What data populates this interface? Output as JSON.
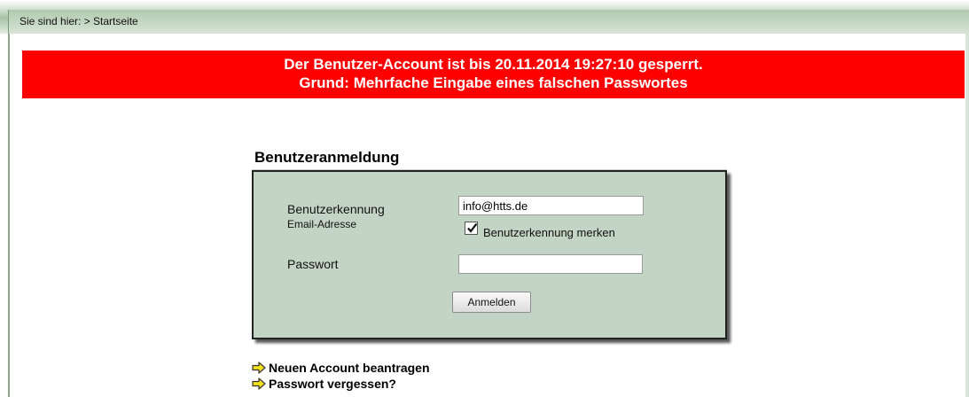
{
  "breadcrumb": {
    "text": "Sie sind hier: > Startseite"
  },
  "alert": {
    "line1": "Der Benutzer-Account ist bis 20.11.2014 19:27:10 gesperrt.",
    "line2": "Grund: Mehrfache Eingabe eines falschen Passwortes",
    "background_color": "#ff0000",
    "text_color": "#ffffff"
  },
  "login": {
    "title": "Benutzeranmeldung",
    "username_label": "Benutzerkennung",
    "username_sublabel": "Email-Adresse",
    "username_value": "info@htts.de",
    "remember_label": "Benutzerkennung merken",
    "remember_checked": true,
    "password_label": "Passwort",
    "password_value": "",
    "submit_label": "Anmelden",
    "box_color": "#c3d3c4"
  },
  "links": [
    {
      "label": "Neuen Account beantragen",
      "icon": "arrow-right-icon"
    },
    {
      "label": "Passwort vergessen?",
      "icon": "arrow-right-icon"
    }
  ]
}
